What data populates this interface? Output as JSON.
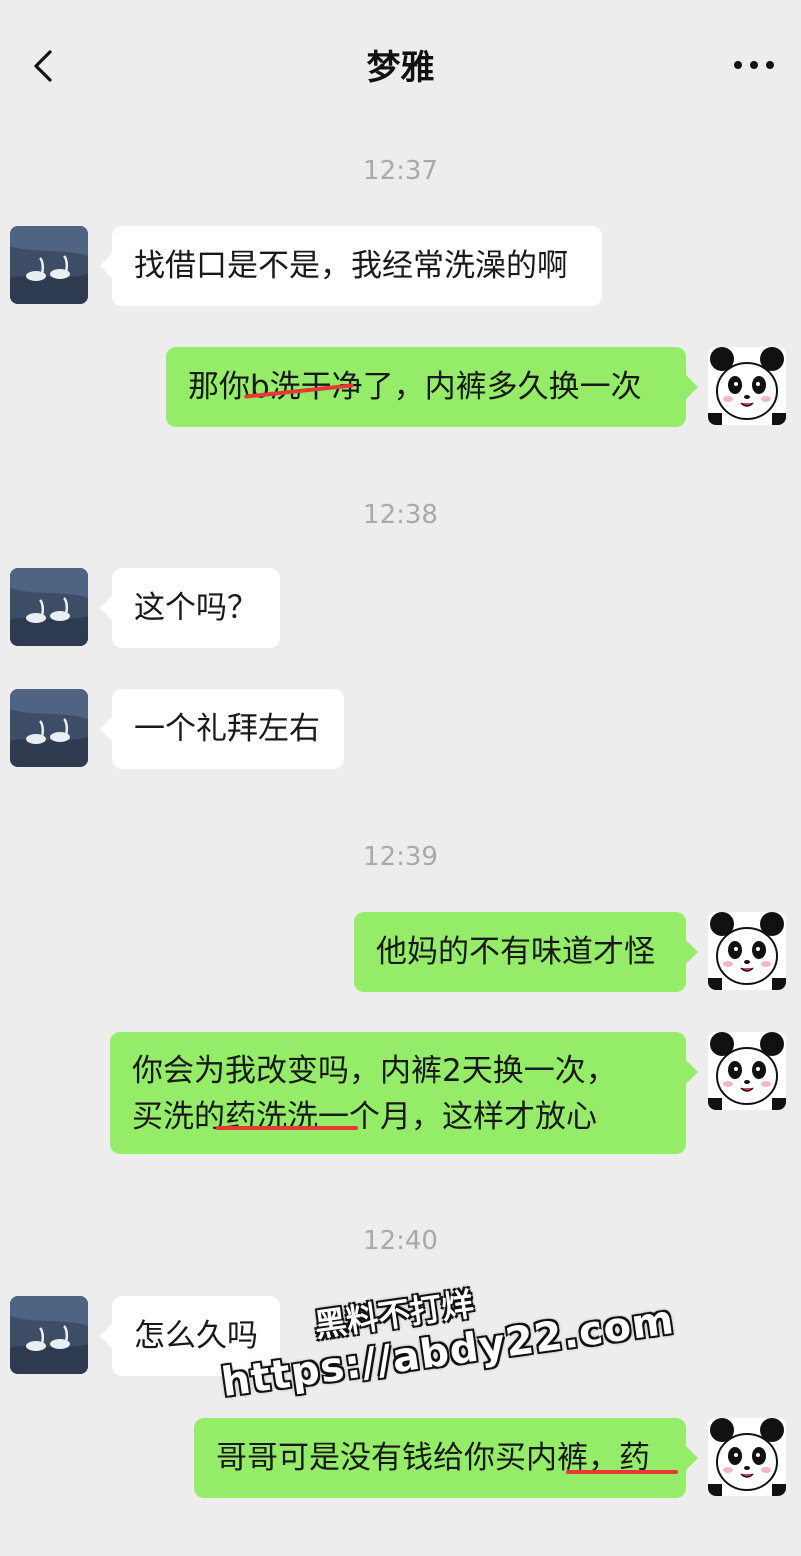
{
  "header": {
    "title": "梦雅",
    "back_icon": "chevron-left-icon",
    "more_icon": "more-dots-icon"
  },
  "timestamps": [
    "12:37",
    "12:38",
    "12:39",
    "12:40"
  ],
  "messages": [
    {
      "from": "contact",
      "text": "找借口是不是，我经常洗澡的啊"
    },
    {
      "from": "me",
      "text": "那你b洗干净了，内裤多久换一次"
    },
    {
      "from": "contact",
      "text": "这个吗？"
    },
    {
      "from": "contact",
      "text": "一个礼拜左右"
    },
    {
      "from": "me",
      "text": "他妈的不有味道才怪"
    },
    {
      "from": "me",
      "lines": [
        "你会为我改变吗，内裤2天换一次，",
        "买洗的药洗洗一个月，这样才放心"
      ]
    },
    {
      "from": "contact",
      "text": "怎么久吗"
    },
    {
      "from": "me",
      "text": "哥哥可是没有钱给你买内裤，药"
    }
  ],
  "watermark": {
    "line1": "黑料不打烊",
    "line2": "https://abdy22.com"
  },
  "colors": {
    "background": "#ededed",
    "incoming_bubble": "#ffffff",
    "outgoing_bubble": "#95ec69",
    "annotation": "#e53935"
  }
}
